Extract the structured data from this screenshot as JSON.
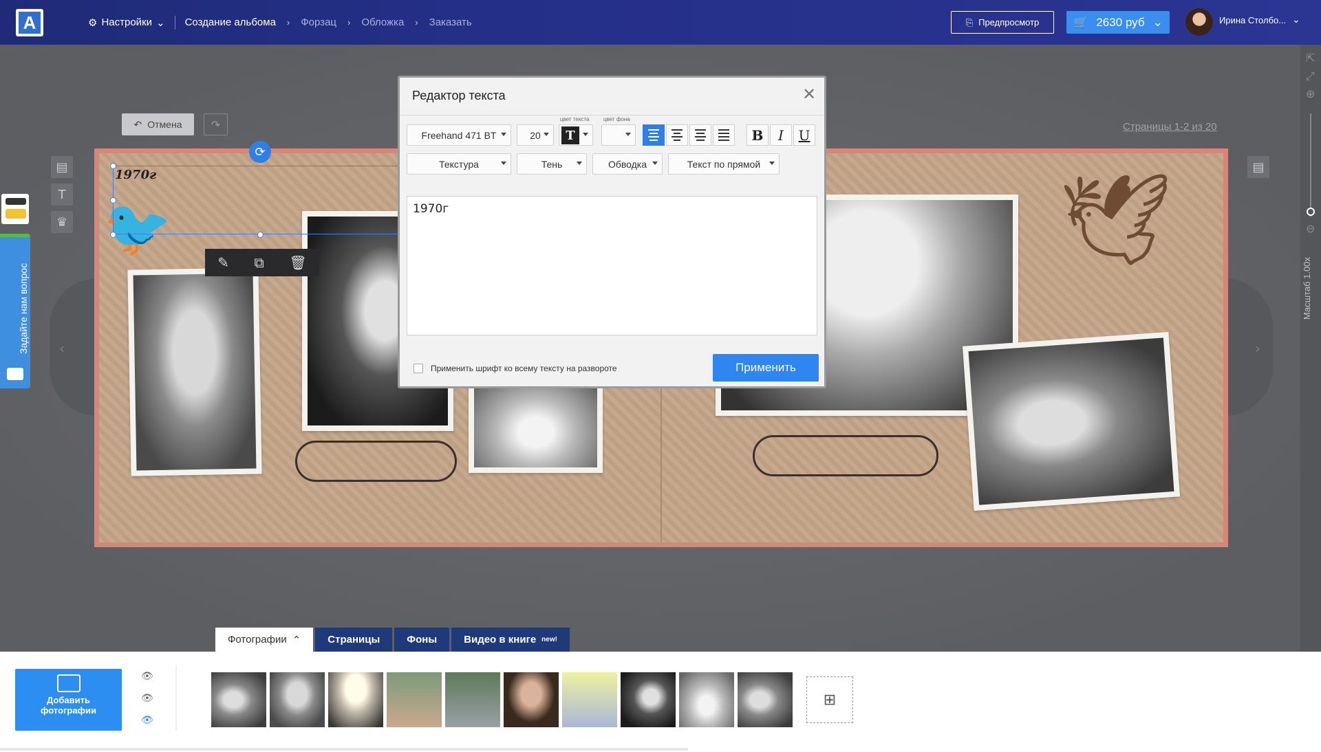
{
  "topbar": {
    "settings_label": "Настройки",
    "crumbs": [
      "Создание альбома",
      "Форзац",
      "Обложка",
      "Заказать"
    ],
    "preview_label": "Предпросмотр",
    "cart_label": "2630 руб",
    "user_name": "Ирина Столбо..."
  },
  "workspace": {
    "undo_label": "Отмена",
    "pages_label": "Страницы 1-2 из 20",
    "zoom_label": "Масштаб 1.00x",
    "ask_label": "Задайте нам вопрос"
  },
  "canvas": {
    "selected_text": "1970г"
  },
  "dialog": {
    "title": "Редактор текста",
    "font": "Freehand 471 BT",
    "size": "20",
    "text_color_label": "цвет текста",
    "bg_color_label": "цвет фона",
    "texture_label": "Текстура",
    "shadow_label": "Тень",
    "stroke_label": "Обводка",
    "path_label": "Текст по прямой",
    "text_value": "1970г",
    "apply_all_label": "Применить шрифт ко всему тексту на развороте",
    "apply_label": "Применить",
    "bold": "B",
    "italic": "I",
    "underline": "U",
    "text_color_glyph": "T"
  },
  "bottom_tabs": {
    "photos": "Фотографии",
    "pages": "Страницы",
    "backgrounds": "Фоны",
    "video": "Видео в книге",
    "video_badge": "new!"
  },
  "photo_panel": {
    "add_label_1": "Добавить",
    "add_label_2": "фотографии"
  }
}
